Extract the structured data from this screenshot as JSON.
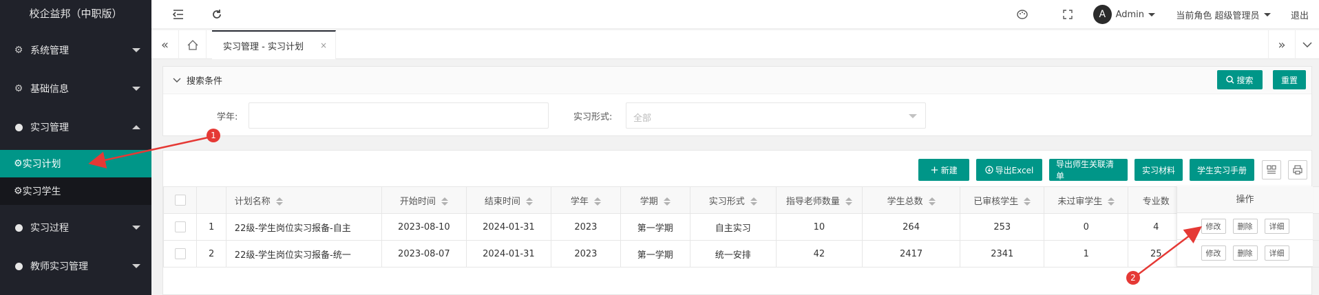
{
  "app": {
    "title": "校企益邦（中职版）"
  },
  "sidebar": {
    "items": [
      {
        "label": "系统管理"
      },
      {
        "label": "基础信息"
      },
      {
        "label": "实习管理"
      },
      {
        "label": "实习计划"
      },
      {
        "label": "实习学生"
      },
      {
        "label": "实习过程"
      },
      {
        "label": "教师实习管理"
      }
    ]
  },
  "header": {
    "avatar_letter": "A",
    "user": "Admin",
    "role": "当前角色 超级管理员",
    "logout": "退出"
  },
  "tabs": {
    "active": "实习管理 - 实习计划",
    "close": "×"
  },
  "search": {
    "title": "搜索条件",
    "search_btn": "搜索",
    "reset_btn": "重置",
    "year_label": "学年:",
    "year_value": "",
    "form_label": "实习形式:",
    "form_placeholder": "全部"
  },
  "toolbar": {
    "new_btn": "新建",
    "export_excel": "导出Excel",
    "export_list": "导出师生关联清单",
    "materials": "实习材料",
    "handbook": "学生实习手册"
  },
  "table": {
    "headers": [
      "计划名称",
      "开始时间",
      "结束时间",
      "学年",
      "学期",
      "实习形式",
      "指导老师数量",
      "学生总数",
      "已审核学生",
      "未过审学生",
      "专业数",
      "操作"
    ],
    "rows": [
      {
        "idx": "1",
        "name": "22级-学生岗位实习报备-自主",
        "start": "2023-08-10",
        "end": "2024-01-31",
        "year": "2023",
        "term": "第一学期",
        "form": "自主实习",
        "teachers": "10",
        "students": "264",
        "approved": "253",
        "failed": "0",
        "majors": "4"
      },
      {
        "idx": "2",
        "name": "22级-学生岗位实习报备-统一",
        "start": "2023-08-07",
        "end": "2024-01-31",
        "year": "2023",
        "term": "第一学期",
        "form": "统一安排",
        "teachers": "42",
        "students": "2417",
        "approved": "2341",
        "failed": "1",
        "majors": "25"
      }
    ],
    "actions": {
      "edit": "修改",
      "delete": "删除",
      "detail": "详细"
    }
  },
  "annotations": {
    "a1": "1",
    "a2": "2"
  },
  "colors": {
    "accent": "#009688",
    "sidebar": "#20222a",
    "annotation": "#e53935"
  }
}
